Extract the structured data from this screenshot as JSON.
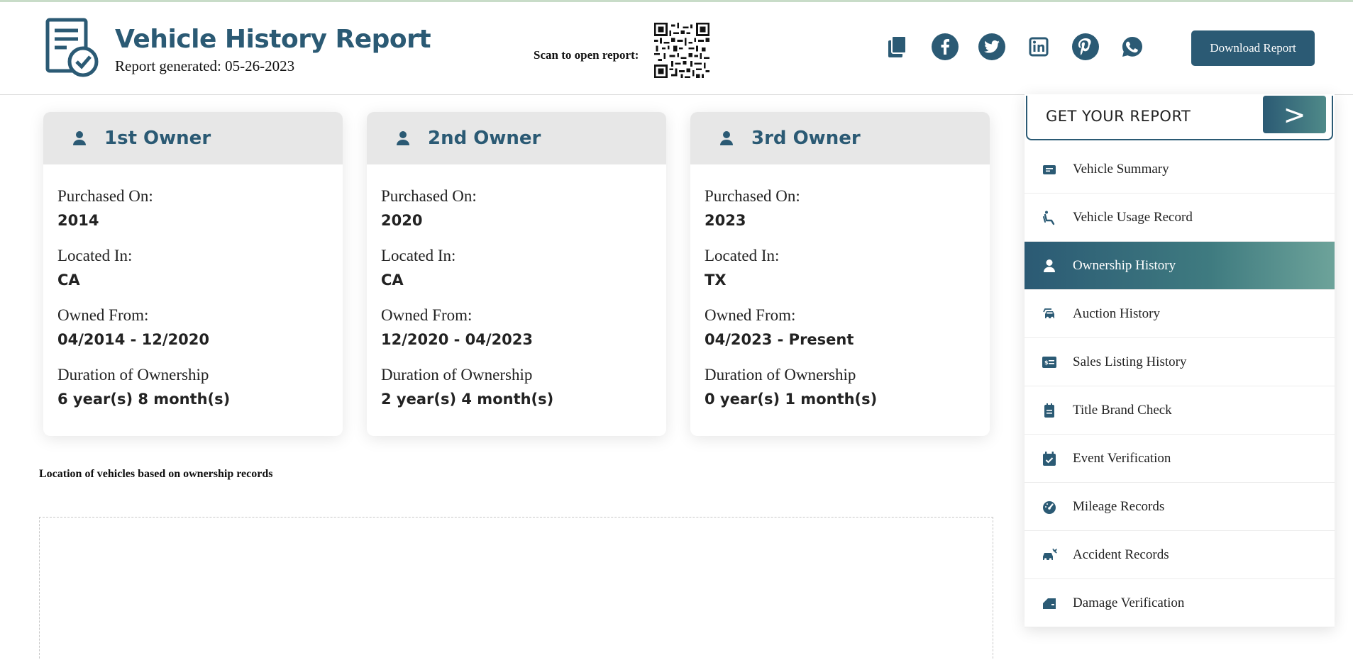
{
  "header": {
    "title": "Vehicle History Report",
    "generated": "Report generated: 05-26-2023",
    "scan_label": "Scan to open report:",
    "download_label": "Download Report",
    "share_icons": [
      "copy-icon",
      "facebook-icon",
      "twitter-icon",
      "linkedin-icon",
      "pinterest-icon",
      "whatsapp-icon"
    ]
  },
  "owners": [
    {
      "title": "1st Owner",
      "purchased_label": "Purchased On:",
      "purchased": "2014",
      "located_label": "Located In:",
      "located": "CA",
      "owned_label": "Owned From:",
      "owned": "04/2014 - 12/2020",
      "duration_label": "Duration of Ownership",
      "duration": "6 year(s) 8 month(s)"
    },
    {
      "title": "2nd Owner",
      "purchased_label": "Purchased On:",
      "purchased": "2020",
      "located_label": "Located In:",
      "located": "CA",
      "owned_label": "Owned From:",
      "owned": "12/2020 - 04/2023",
      "duration_label": "Duration of Ownership",
      "duration": "2 year(s) 4 month(s)"
    },
    {
      "title": "3rd Owner",
      "purchased_label": "Purchased On:",
      "purchased": "2023",
      "located_label": "Located In:",
      "located": "TX",
      "owned_label": "Owned From:",
      "owned": "04/2023 - Present",
      "duration_label": "Duration of Ownership",
      "duration": "0 year(s) 1 month(s)"
    }
  ],
  "map": {
    "caption": "Location of vehicles based on ownership records"
  },
  "sidebar": {
    "get_report_label": "GET YOUR REPORT",
    "get_report_arrow": ">",
    "active_index": 2,
    "items": [
      {
        "label": "Vehicle Summary",
        "icon": "summary-icon"
      },
      {
        "label": "Vehicle Usage Record",
        "icon": "seat-icon"
      },
      {
        "label": "Ownership History",
        "icon": "person-icon"
      },
      {
        "label": "Auction History",
        "icon": "car-stack-icon"
      },
      {
        "label": "Sales Listing History",
        "icon": "price-tag-icon"
      },
      {
        "label": "Title Brand Check",
        "icon": "document-icon"
      },
      {
        "label": "Event Verification",
        "icon": "calendar-check-icon"
      },
      {
        "label": "Mileage Records",
        "icon": "speedometer-icon"
      },
      {
        "label": "Accident Records",
        "icon": "car-crash-icon"
      },
      {
        "label": "Damage Verification",
        "icon": "car-door-icon"
      }
    ]
  },
  "colors": {
    "primary": "#2b5a74",
    "accent_end": "#6da39a",
    "card_header": "#e7e7e7"
  }
}
